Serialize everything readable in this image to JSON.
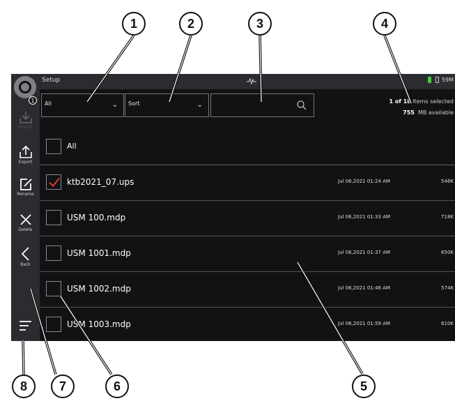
{
  "header": {
    "title": "Setup",
    "battery_text": "59M",
    "notification_count": "1"
  },
  "filters": {
    "filter_value": "All",
    "sort_value": "Sort",
    "search_value": ""
  },
  "selection": {
    "selected_count": "1 of 18",
    "selected_suffix": "Items selected",
    "mb_value": "755",
    "mb_suffix": "MB available"
  },
  "sidebar": {
    "import_label": "Import",
    "export_label": "Export",
    "rename_label": "Rename",
    "delete_label": "Delete",
    "back_label": "Back"
  },
  "list": {
    "all_label": "All",
    "files": [
      {
        "name": "ktb2021_07.ups",
        "date": "Jul 06,2021 01:24 AM",
        "size": "546K",
        "checked": true
      },
      {
        "name": "USM 100.mdp",
        "date": "Jul 06,2021 01:33 AM",
        "size": "718K",
        "checked": false
      },
      {
        "name": "USM 1001.mdp",
        "date": "Jul 06,2021 01:37 AM",
        "size": "650K",
        "checked": false
      },
      {
        "name": "USM 1002.mdp",
        "date": "Jul 06,2021 01:46 AM",
        "size": "574K",
        "checked": false
      },
      {
        "name": "USM 1003.mdp",
        "date": "Jul 06,2021 01:59 AM",
        "size": "610K",
        "checked": false
      }
    ]
  },
  "callouts": [
    "1",
    "2",
    "3",
    "4",
    "5",
    "6",
    "7",
    "8"
  ],
  "colors": {
    "accent_check": "#e03a2c",
    "battery": "#3fd13f",
    "background": "#111214",
    "panel": "#2b2c2f"
  },
  "icons": [
    "logo-icon",
    "import-icon",
    "export-icon",
    "rename-icon",
    "delete-icon",
    "back-icon",
    "menu-icon",
    "search-icon",
    "chevron-down-icon",
    "waveform-icon",
    "battery-icon"
  ]
}
